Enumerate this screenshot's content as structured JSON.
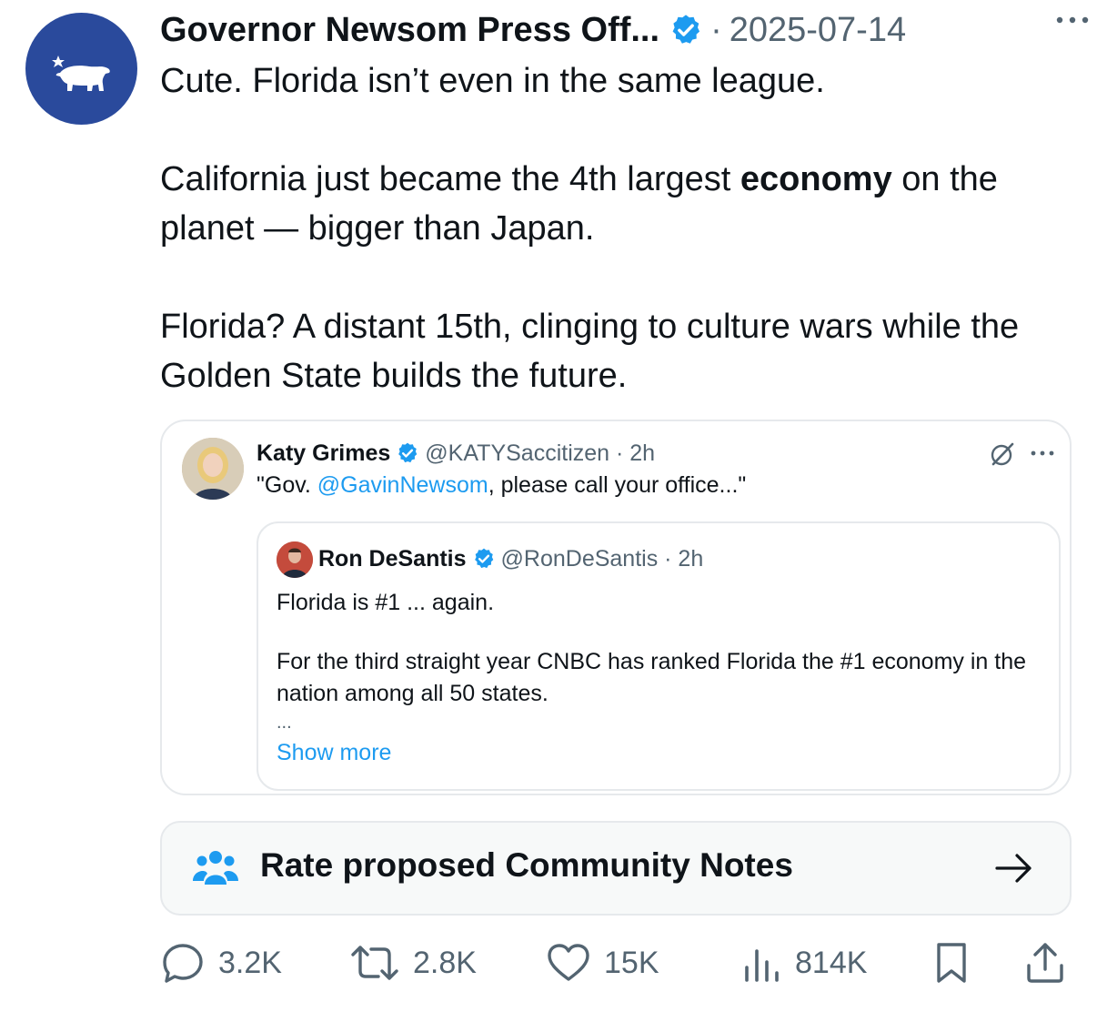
{
  "post": {
    "author": "Governor Newsom Press Off...",
    "separator": "·",
    "date": "2025-07-14",
    "line1": "Cute. Florida isn’t even in the same league.",
    "para2_before": "California just became the 4th largest ",
    "para2_bold": "economy",
    "para2_after": " on the planet — bigger than Japan.",
    "para3": "Florida? A distant 15th, clinging to culture wars while the Golden State builds the future."
  },
  "quote": {
    "author": "Katy Grimes",
    "handle_time": "@KATYSaccitizen · 2h",
    "text_before": "\"Gov. ",
    "text_link": "@GavinNewsom",
    "text_after": ", please call your office...\"",
    "inner": {
      "author": "Ron DeSantis",
      "handle_time": "@RonDeSantis · 2h",
      "line1": "Florida is #1 ... again.",
      "line2": "For the third straight year CNBC has ranked Florida the #1 economy in the nation among all 50 states.",
      "ellipsis": "...",
      "show_more": "Show more"
    }
  },
  "community_notes": {
    "label": "Rate proposed Community Notes"
  },
  "actions": {
    "replies": "3.2K",
    "reposts": "2.8K",
    "likes": "15K",
    "views": "814K"
  },
  "colors": {
    "avatar_bg": "#2a4a9c",
    "verified": "#1d9bf0",
    "link": "#1d9bf0",
    "muted": "#536471",
    "border": "#e6e9ec",
    "notes_bg": "#f7f9f9"
  },
  "icons": [
    "california-bear-logo",
    "verified-badge-icon",
    "more-icon",
    "grok-icon",
    "community-notes-people-icon",
    "arrow-right-icon",
    "reply-icon",
    "repost-icon",
    "like-icon",
    "views-icon",
    "bookmark-icon",
    "share-icon"
  ]
}
